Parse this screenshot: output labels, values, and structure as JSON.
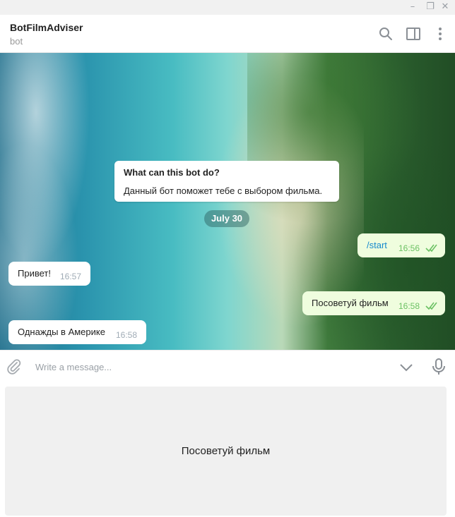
{
  "window": {
    "minimize_glyph": "–",
    "maximize_glyph": "❐",
    "close_glyph": "✕"
  },
  "header": {
    "title": "BotFilmAdviser",
    "subtitle": "bot",
    "icons": [
      "search-icon",
      "sidebar-panel-icon",
      "more-vertical-icon"
    ]
  },
  "chat": {
    "info_card": {
      "title": "What can this bot do?",
      "text": "Данный бот поможет тебе с выбором фильма."
    },
    "date_label": "July 30",
    "messages": [
      {
        "direction": "out",
        "text": "/start",
        "time": "16:56",
        "read": true
      },
      {
        "direction": "in",
        "text": "Привет!",
        "time": "16:57"
      },
      {
        "direction": "out",
        "text": "Посоветуй фильм",
        "time": "16:58",
        "read": true
      },
      {
        "direction": "in",
        "text": "Однажды в Америке",
        "time": "16:58"
      }
    ]
  },
  "composer": {
    "placeholder": "Write a message...",
    "value": ""
  },
  "keyboard": {
    "buttons": [
      "Посоветуй фильм"
    ]
  },
  "colors": {
    "accent_blue": "#168acd",
    "read_ticks": "#6cc264",
    "outgoing_bubble": "#effdde",
    "incoming_bubble": "#ffffff"
  }
}
